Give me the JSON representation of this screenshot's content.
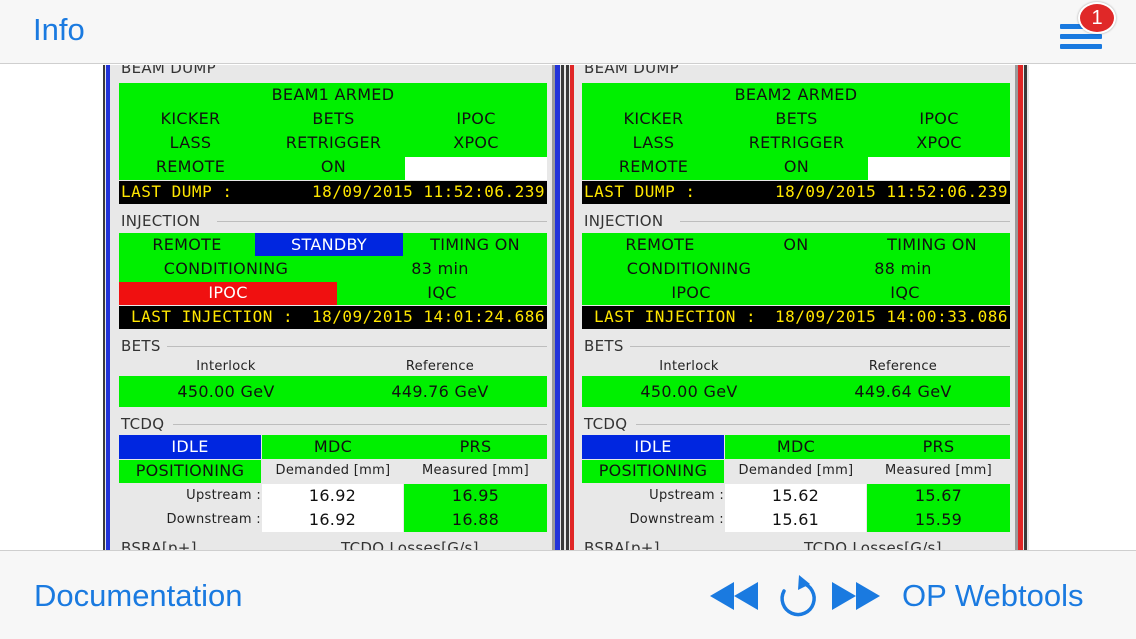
{
  "nav": {
    "title": "Info",
    "badge_count": "1"
  },
  "toolbar": {
    "documentation": "Documentation",
    "op_webtools": "OP Webtools"
  },
  "colors": {
    "accent": "#1a7ae0",
    "green": "#00f000",
    "blue": "#0026e0",
    "red": "#f01010",
    "yellow": "#ffe600",
    "badge": "#e02828"
  },
  "icons": {
    "menu": "menu-icon",
    "rewind": "rewind-icon",
    "refresh": "refresh-icon",
    "forward": "fast-forward-icon"
  },
  "beams": [
    {
      "beam_dump": {
        "title": "BEAM DUMP",
        "status": "BEAM1 ARMED",
        "row1": [
          "KICKER",
          "BETS",
          "IPOC"
        ],
        "row2": [
          "LASS",
          "RETRIGGER",
          "XPOC"
        ],
        "row3": [
          "REMOTE",
          "ON"
        ],
        "last_dump_label": "LAST DUMP :",
        "last_dump_value": "18/09/2015 11:52:06.239"
      },
      "injection": {
        "title": "INJECTION",
        "remote": "REMOTE",
        "mode": "STANDBY",
        "timing": "TIMING ON",
        "conditioning": "CONDITIONING",
        "conditioning_value": "83 min",
        "ipoc": "IPOC",
        "iqc": "IQC",
        "last_injection_label": "LAST INJECTION :",
        "last_injection_value": "18/09/2015 14:01:24.686"
      },
      "bets": {
        "title": "BETS",
        "interlock_label": "Interlock",
        "reference_label": "Reference",
        "interlock_value": "450.00 GeV",
        "reference_value": "449.76 GeV"
      },
      "tcdq": {
        "title": "TCDQ",
        "state": "IDLE",
        "mdc": "MDC",
        "prs": "PRS",
        "positioning": "POSITIONING",
        "demanded_label": "Demanded [mm]",
        "measured_label": "Measured [mm]",
        "upstream_label": "Upstream :",
        "downstream_label": "Downstream :",
        "upstream_demanded": "16.92",
        "upstream_measured": "16.95",
        "downstream_demanded": "16.92",
        "downstream_measured": "16.88"
      },
      "footer": {
        "bsra": "BSRA[p+]",
        "losses": "TCDQ Losses[G/s]"
      }
    },
    {
      "beam_dump": {
        "title": "BEAM DUMP",
        "status": "BEAM2 ARMED",
        "row1": [
          "KICKER",
          "BETS",
          "IPOC"
        ],
        "row2": [
          "LASS",
          "RETRIGGER",
          "XPOC"
        ],
        "row3": [
          "REMOTE",
          "ON"
        ],
        "last_dump_label": "LAST DUMP :",
        "last_dump_value": "18/09/2015 11:52:06.239"
      },
      "injection": {
        "title": "INJECTION",
        "remote": "REMOTE",
        "mode": "ON",
        "timing": "TIMING ON",
        "conditioning": "CONDITIONING",
        "conditioning_value": "88 min",
        "ipoc": "IPOC",
        "iqc": "IQC",
        "last_injection_label": "LAST INJECTION :",
        "last_injection_value": "18/09/2015 14:00:33.086"
      },
      "bets": {
        "title": "BETS",
        "interlock_label": "Interlock",
        "reference_label": "Reference",
        "interlock_value": "450.00 GeV",
        "reference_value": "449.64 GeV"
      },
      "tcdq": {
        "title": "TCDQ",
        "state": "IDLE",
        "mdc": "MDC",
        "prs": "PRS",
        "positioning": "POSITIONING",
        "demanded_label": "Demanded [mm]",
        "measured_label": "Measured [mm]",
        "upstream_label": "Upstream :",
        "downstream_label": "Downstream :",
        "upstream_demanded": "15.62",
        "upstream_measured": "15.67",
        "downstream_demanded": "15.61",
        "downstream_measured": "15.59"
      },
      "footer": {
        "bsra": "BSRA[p+]",
        "losses": "TCDQ Losses[G/s]"
      }
    }
  ]
}
